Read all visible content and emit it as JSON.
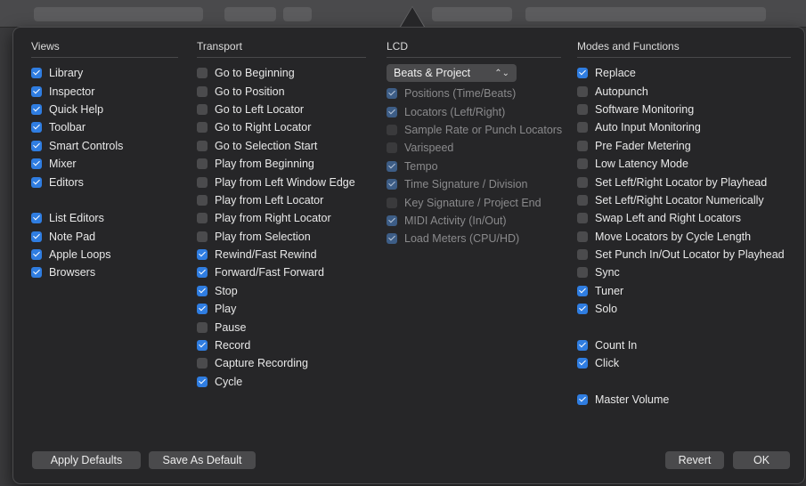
{
  "views": {
    "title": "Views",
    "items": [
      {
        "label": "Library",
        "checked": true
      },
      {
        "label": "Inspector",
        "checked": true
      },
      {
        "label": "Quick Help",
        "checked": true
      },
      {
        "label": "Toolbar",
        "checked": true
      },
      {
        "label": "Smart Controls",
        "checked": true
      },
      {
        "label": "Mixer",
        "checked": true
      },
      {
        "label": "Editors",
        "checked": true
      },
      null,
      {
        "label": "List Editors",
        "checked": true
      },
      {
        "label": "Note Pad",
        "checked": true
      },
      {
        "label": "Apple Loops",
        "checked": true
      },
      {
        "label": "Browsers",
        "checked": true
      }
    ]
  },
  "transport": {
    "title": "Transport",
    "items": [
      {
        "label": "Go to Beginning",
        "checked": false
      },
      {
        "label": "Go to Position",
        "checked": false
      },
      {
        "label": "Go to Left Locator",
        "checked": false
      },
      {
        "label": "Go to Right Locator",
        "checked": false
      },
      {
        "label": "Go to Selection Start",
        "checked": false
      },
      {
        "label": "Play from Beginning",
        "checked": false
      },
      {
        "label": "Play from Left Window Edge",
        "checked": false
      },
      {
        "label": "Play from Left Locator",
        "checked": false
      },
      {
        "label": "Play from Right Locator",
        "checked": false
      },
      {
        "label": "Play from Selection",
        "checked": false
      },
      {
        "label": "Rewind/Fast Rewind",
        "checked": true
      },
      {
        "label": "Forward/Fast Forward",
        "checked": true
      },
      {
        "label": "Stop",
        "checked": true
      },
      {
        "label": "Play",
        "checked": true
      },
      {
        "label": "Pause",
        "checked": false
      },
      {
        "label": "Record",
        "checked": true
      },
      {
        "label": "Capture Recording",
        "checked": false
      },
      {
        "label": "Cycle",
        "checked": true
      }
    ]
  },
  "lcd": {
    "title": "LCD",
    "select_value": "Beats & Project",
    "items": [
      {
        "label": "Positions (Time/Beats)",
        "checked": true
      },
      {
        "label": "Locators (Left/Right)",
        "checked": true
      },
      {
        "label": "Sample Rate or Punch Locators",
        "checked": false
      },
      {
        "label": "Varispeed",
        "checked": false
      },
      {
        "label": "Tempo",
        "checked": true
      },
      {
        "label": "Time Signature / Division",
        "checked": true
      },
      {
        "label": "Key Signature / Project End",
        "checked": false
      },
      {
        "label": "MIDI Activity (In/Out)",
        "checked": true
      },
      {
        "label": "Load Meters (CPU/HD)",
        "checked": true
      }
    ]
  },
  "modes": {
    "title": "Modes and Functions",
    "items": [
      {
        "label": "Replace",
        "checked": true
      },
      {
        "label": "Autopunch",
        "checked": false
      },
      {
        "label": "Software Monitoring",
        "checked": false
      },
      {
        "label": "Auto Input Monitoring",
        "checked": false
      },
      {
        "label": "Pre Fader Metering",
        "checked": false
      },
      {
        "label": "Low Latency Mode",
        "checked": false
      },
      {
        "label": "Set Left/Right Locator by Playhead",
        "checked": false
      },
      {
        "label": "Set Left/Right Locator Numerically",
        "checked": false
      },
      {
        "label": "Swap Left and Right Locators",
        "checked": false
      },
      {
        "label": "Move Locators by Cycle Length",
        "checked": false
      },
      {
        "label": "Set Punch In/Out Locator by Playhead",
        "checked": false
      },
      {
        "label": "Sync",
        "checked": false
      },
      {
        "label": "Tuner",
        "checked": true
      },
      {
        "label": "Solo",
        "checked": true
      },
      null,
      {
        "label": "Count In",
        "checked": true
      },
      {
        "label": "Click",
        "checked": true
      },
      null,
      {
        "label": "Master Volume",
        "checked": true
      }
    ]
  },
  "buttons": {
    "apply_defaults": "Apply Defaults",
    "save_as_default": "Save As Default",
    "revert": "Revert",
    "ok": "OK"
  }
}
